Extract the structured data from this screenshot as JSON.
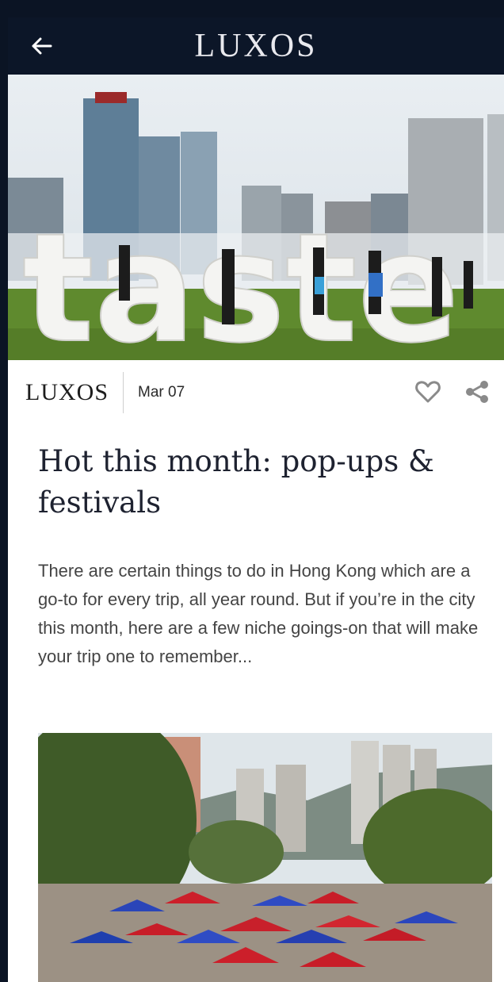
{
  "app_bar": {
    "title": "LUXOS"
  },
  "article": {
    "brand": "LUXOS",
    "date": "Mar 07",
    "title": "Hot this month: pop-ups & festivals",
    "excerpt": "There are certain things to do in Hong Kong which are a go-to for every trip, all year round. But if you’re in the city this month, here are a few niche goings-on that will make your trip one to remember...",
    "hero_sign_text": "taste"
  },
  "icons": {
    "back": "arrow-left-icon",
    "like": "heart-icon",
    "share": "share-icon"
  },
  "colors": {
    "app_bar": "#0c1628",
    "background": "#ffffff",
    "title_text": "#1e2230",
    "body_text": "#444444",
    "icon_gray": "#8a8a8a"
  }
}
